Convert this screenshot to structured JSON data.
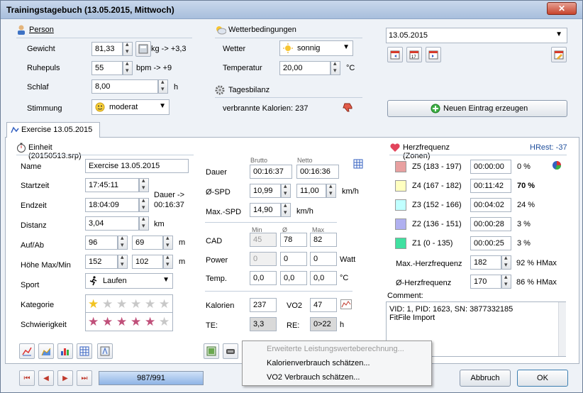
{
  "window": {
    "title": "Trainingstagebuch (13.05.2015, Mittwoch)",
    "close": "✕"
  },
  "person": {
    "title": "Person",
    "gewicht_label": "Gewicht",
    "gewicht_value": "81,33",
    "gewicht_unit": "kg  -> +3,3",
    "ruhepuls_label": "Ruhepuls",
    "ruhepuls_value": "55",
    "ruhepuls_unit": "bpm  -> +9",
    "schlaf_label": "Schlaf",
    "schlaf_value": "8,00",
    "schlaf_unit": "h",
    "stimmung_label": "Stimmung",
    "stimmung_value": "moderat"
  },
  "wetter": {
    "title": "Wetterbedingungen",
    "wetter_label": "Wetter",
    "wetter_value": "sonnig",
    "temp_label": "Temperatur",
    "temp_value": "20,00",
    "temp_unit": "°C"
  },
  "tagesbilanz": {
    "title": "Tagesbilanz",
    "text": "verbrannte Kalorien: 237"
  },
  "date": {
    "value": "13.05.2015"
  },
  "new_entry": "Neuen Eintrag erzeugen",
  "tab": {
    "label": "Exercise 13.05.2015"
  },
  "einheit": {
    "title": "Einheit (20150513.srp)",
    "name_label": "Name",
    "name_value": "Exercise 13.05.2015",
    "startzeit_label": "Startzeit",
    "startzeit_value": "17:45:11",
    "endzeit_label": "Endzeit",
    "endzeit_value": "18:04:09",
    "dauer_note1": "Dauer ->",
    "dauer_note2": "00:16:37",
    "distanz_label": "Distanz",
    "distanz_value": "3,04",
    "distanz_unit": "km",
    "aufab_label": "Auf/Ab",
    "auf_value": "96",
    "ab_value": "69",
    "aufab_unit": "m",
    "hoehe_label": "Höhe Max/Min",
    "hoehe_max": "152",
    "hoehe_min": "102",
    "hoehe_unit": "m",
    "sport_label": "Sport",
    "sport_value": "Laufen",
    "kategorie_label": "Kategorie",
    "kategorie_stars": 1,
    "schwierigkeit_label": "Schwierigkeit",
    "schwierigkeit_stars": 5
  },
  "metrics": {
    "brutto_hdr": "Brutto",
    "netto_hdr": "Netto",
    "dauer_label": "Dauer",
    "dauer_brutto": "00:16:37",
    "dauer_netto": "00:16:36",
    "spd_label": "Ø-SPD",
    "spd_brutto": "10,99",
    "spd_netto": "11,00",
    "spd_unit": "km/h",
    "maxspd_label": "Max.-SPD",
    "maxspd_value": "14,90",
    "maxspd_unit": "km/h",
    "min_hdr": "Min",
    "avg_hdr": "Ø",
    "max_hdr": "Max",
    "cad_label": "CAD",
    "cad_min": "45",
    "cad_avg": "78",
    "cad_max": "82",
    "power_label": "Power",
    "power_min": "0",
    "power_avg": "0",
    "power_max": "0",
    "power_unit": "Watt",
    "temp_label": "Temp.",
    "temp_min": "0,0",
    "temp_avg": "0,0",
    "temp_max": "0,0",
    "temp_unit": "°C",
    "kal_label": "Kalorien",
    "kal_value": "237",
    "vo2_label": "VO2",
    "vo2_value": "47",
    "te_label": "TE:",
    "te_value": "3,3",
    "re_label": "RE:",
    "re_value": "0>22",
    "re_unit": "h"
  },
  "hr": {
    "title": "Herzfrequenz (Zonen)",
    "hrest": "HRest: -37",
    "zones": [
      {
        "label": "Z5 (183 - 197)",
        "time": "00:00:00",
        "pct": "0 %",
        "color": "#e8a0a0"
      },
      {
        "label": "Z4 (167 - 182)",
        "time": "00:11:42",
        "pct": "70 %",
        "color": "#ffffc0"
      },
      {
        "label": "Z3 (152 - 166)",
        "time": "00:04:02",
        "pct": "24 %",
        "color": "#c0ffff"
      },
      {
        "label": "Z2 (136 - 151)",
        "time": "00:00:28",
        "pct": "3 %",
        "color": "#b0b0f0"
      },
      {
        "label": "Z1 (0 - 135)",
        "time": "00:00:25",
        "pct": "3 %",
        "color": "#40e0a0"
      }
    ],
    "max_label": "Max.-Herzfrequenz",
    "max_value": "182",
    "max_pct": "92 % HMax",
    "avg_label": "Ø-Herzfrequenz",
    "avg_value": "170",
    "avg_pct": "86 % HMax"
  },
  "comment": {
    "label": "Comment:",
    "line1": "VID: 1, PID: 1623, SN: 3877332185",
    "line2": "FitFile Import"
  },
  "menu": {
    "item1": "Erweiterte Leistungswerteberechnung...",
    "item2": "Kalorienverbrauch schätzen...",
    "item3": "VO2 Verbrauch schätzen..."
  },
  "nav": {
    "progress": "987/991",
    "progress_fraction": 0.996
  },
  "buttons": {
    "cancel": "Abbruch",
    "ok": "OK"
  }
}
